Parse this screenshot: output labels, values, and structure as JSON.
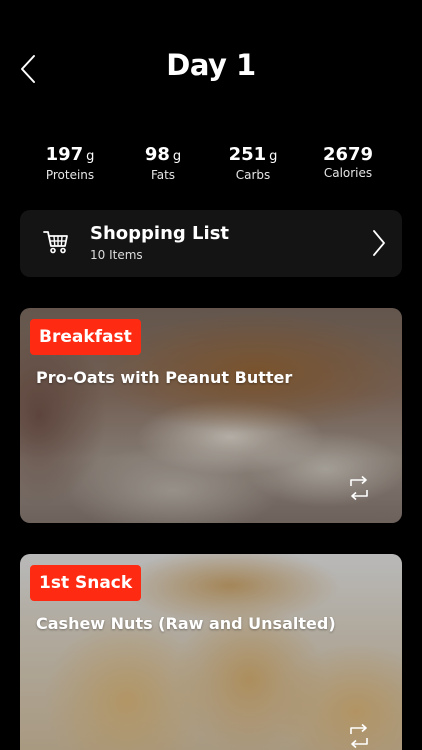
{
  "header": {
    "title": "Day 1"
  },
  "macros": [
    {
      "value": "197",
      "unit": "g",
      "label": "Proteins"
    },
    {
      "value": "98",
      "unit": "g",
      "label": "Fats"
    },
    {
      "value": "251",
      "unit": "g",
      "label": "Carbs"
    },
    {
      "value": "2679",
      "unit": "",
      "label": "Calories"
    }
  ],
  "shopping_list": {
    "title": "Shopping List",
    "subtitle": "10 Items",
    "icon": "shopping-cart-icon"
  },
  "meals": [
    {
      "badge": "Breakfast",
      "name": "Pro-Oats with Peanut Butter",
      "action_icon": "swap-icon"
    },
    {
      "badge": "1st Snack",
      "name": "Cashew Nuts (Raw and Unsalted)",
      "action_icon": "swap-icon"
    }
  ],
  "colors": {
    "background": "#000000",
    "card": "#141414",
    "accent": "#ff2a12",
    "text": "#ffffff"
  }
}
